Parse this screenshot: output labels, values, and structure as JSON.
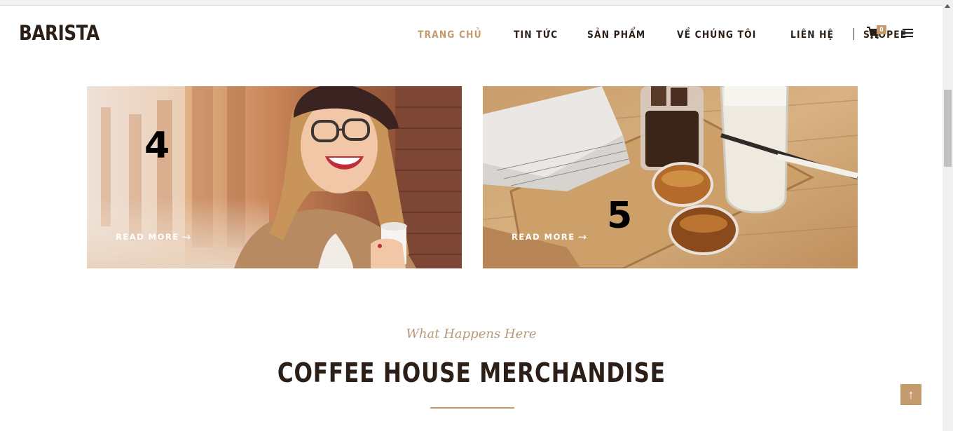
{
  "header": {
    "logo": "BARISTA",
    "nav": [
      {
        "label": "TRANG CHỦ",
        "active": true
      },
      {
        "label": "TIN TỨC",
        "active": false
      },
      {
        "label": "SẢN PHẨM",
        "active": false
      },
      {
        "label": "VỀ CHÚNG TÔI",
        "active": false
      },
      {
        "label": "LIÊN HỆ",
        "active": false
      },
      {
        "label": "SHOPEE",
        "active": false
      }
    ],
    "cart_count": "0",
    "cart_icon": "shopping-cart-icon",
    "menu_icon": "hamburger-menu-icon"
  },
  "cards": [
    {
      "number": "4",
      "read_more": "READ MORE",
      "arrow": "→",
      "image": "woman-smiling-with-coffee-cup"
    },
    {
      "number": "5",
      "read_more": "READ MORE",
      "arrow": "→",
      "image": "iced-coffee-and-milk-on-wooden-tray"
    }
  ],
  "section": {
    "subtitle": "What Happens Here",
    "title": "COFFEE HOUSE MERCHANDISE"
  },
  "scroll_top": {
    "icon": "arrow-up-icon",
    "glyph": "↑"
  },
  "colors": {
    "accent": "#c49b6c",
    "dark": "#2b1f17",
    "subtitle": "#b89a7a"
  }
}
